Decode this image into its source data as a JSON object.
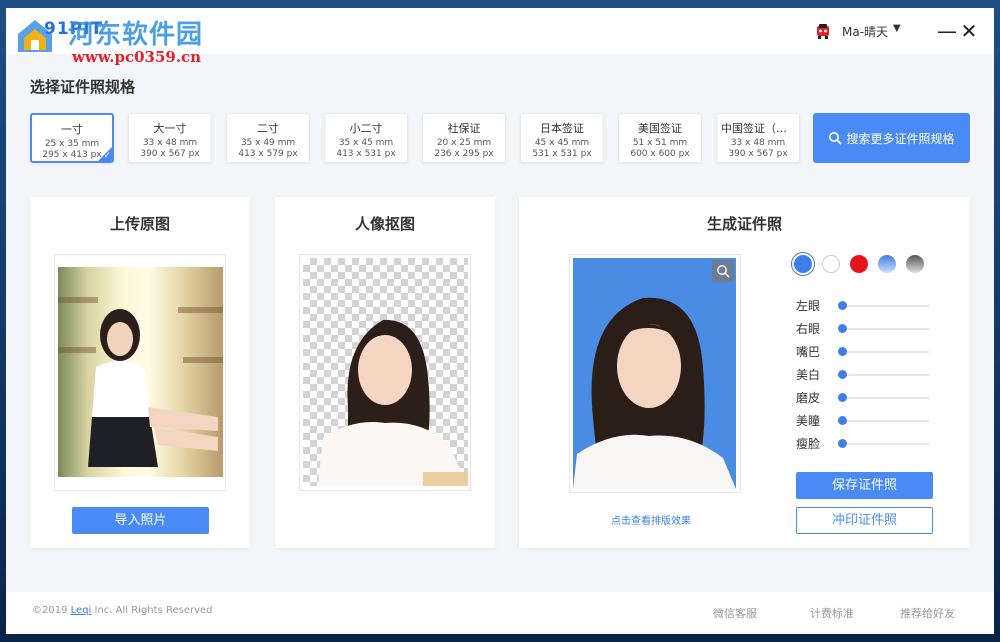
{
  "titlebar": {
    "app_name": "91PIT",
    "watermark_title": "河东软件园",
    "watermark_url": "www.pc0359.cn",
    "user_name": "Ma-晴天",
    "user_caret": "▼",
    "minimize_glyph": "—",
    "close_glyph": "✕"
  },
  "section_title": "选择证件照规格",
  "specs": [
    {
      "name": "一寸",
      "mm": "25 x 35 mm",
      "px": "295 x 413 px",
      "selected": true
    },
    {
      "name": "大一寸",
      "mm": "33 x 48 mm",
      "px": "390 x 567 px"
    },
    {
      "name": "二寸",
      "mm": "35 x 49 mm",
      "px": "413 x 579 px"
    },
    {
      "name": "小二寸",
      "mm": "35 x 45 mm",
      "px": "413 x 531 px"
    },
    {
      "name": "社保证",
      "mm": "20 x 25 mm",
      "px": "236 x 295 px"
    },
    {
      "name": "日本签证",
      "mm": "45 x 45 mm",
      "px": "531 x 531 px"
    },
    {
      "name": "美国签证",
      "mm": "51 x 51 mm",
      "px": "600 x 600 px"
    },
    {
      "name": "中国签证（大…",
      "mm": "33 x 48 mm",
      "px": "390 x 567 px"
    }
  ],
  "search_spec_label": "搜索更多证件照规格",
  "panels": {
    "upload": {
      "title": "上传原图",
      "import_label": "导入照片"
    },
    "cutout": {
      "title": "人像抠图"
    },
    "generate": {
      "title": "生成证件照",
      "layout_link": "点击查看排版效果",
      "save_label": "保存证件照",
      "print_label": "冲印证件照"
    }
  },
  "background_colors": [
    {
      "name": "blue",
      "color": "#3d7fe6",
      "selected": true
    },
    {
      "name": "white",
      "color": "#ffffff"
    },
    {
      "name": "red",
      "color": "#e8141b"
    },
    {
      "name": "gradient-blue",
      "color": "#6ea6ee"
    },
    {
      "name": "gradient-gray",
      "color": "#888888"
    }
  ],
  "sliders": [
    {
      "label": "左眼",
      "value": 0
    },
    {
      "label": "右眼",
      "value": 0
    },
    {
      "label": "嘴巴",
      "value": 0
    },
    {
      "label": "美白",
      "value": 0
    },
    {
      "label": "磨皮",
      "value": 0
    },
    {
      "label": "美瞳",
      "value": 0
    },
    {
      "label": "瘦脸",
      "value": 0
    }
  ],
  "footer": {
    "copyright_prefix": "©2019",
    "brand": "Leqi",
    "copyright_suffix": "Inc. All Rights Reserved",
    "links": [
      "微信客服",
      "计费标准",
      "推荐给好友"
    ]
  }
}
